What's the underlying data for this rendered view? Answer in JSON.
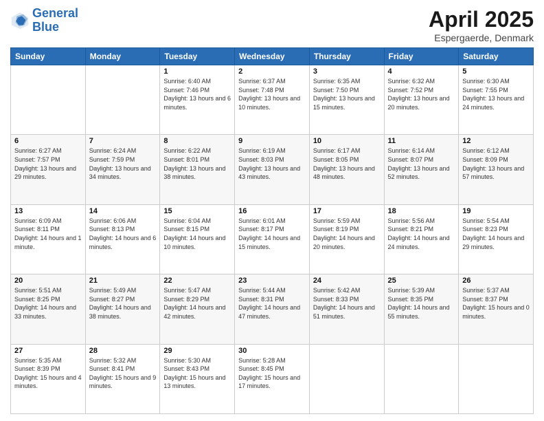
{
  "logo": {
    "line1": "General",
    "line2": "Blue"
  },
  "title": "April 2025",
  "location": "Espergaerde, Denmark",
  "weekdays": [
    "Sunday",
    "Monday",
    "Tuesday",
    "Wednesday",
    "Thursday",
    "Friday",
    "Saturday"
  ],
  "days": [
    {
      "num": "",
      "info": ""
    },
    {
      "num": "",
      "info": ""
    },
    {
      "num": "1",
      "info": "Sunrise: 6:40 AM\nSunset: 7:46 PM\nDaylight: 13 hours and 6 minutes."
    },
    {
      "num": "2",
      "info": "Sunrise: 6:37 AM\nSunset: 7:48 PM\nDaylight: 13 hours and 10 minutes."
    },
    {
      "num": "3",
      "info": "Sunrise: 6:35 AM\nSunset: 7:50 PM\nDaylight: 13 hours and 15 minutes."
    },
    {
      "num": "4",
      "info": "Sunrise: 6:32 AM\nSunset: 7:52 PM\nDaylight: 13 hours and 20 minutes."
    },
    {
      "num": "5",
      "info": "Sunrise: 6:30 AM\nSunset: 7:55 PM\nDaylight: 13 hours and 24 minutes."
    },
    {
      "num": "6",
      "info": "Sunrise: 6:27 AM\nSunset: 7:57 PM\nDaylight: 13 hours and 29 minutes."
    },
    {
      "num": "7",
      "info": "Sunrise: 6:24 AM\nSunset: 7:59 PM\nDaylight: 13 hours and 34 minutes."
    },
    {
      "num": "8",
      "info": "Sunrise: 6:22 AM\nSunset: 8:01 PM\nDaylight: 13 hours and 38 minutes."
    },
    {
      "num": "9",
      "info": "Sunrise: 6:19 AM\nSunset: 8:03 PM\nDaylight: 13 hours and 43 minutes."
    },
    {
      "num": "10",
      "info": "Sunrise: 6:17 AM\nSunset: 8:05 PM\nDaylight: 13 hours and 48 minutes."
    },
    {
      "num": "11",
      "info": "Sunrise: 6:14 AM\nSunset: 8:07 PM\nDaylight: 13 hours and 52 minutes."
    },
    {
      "num": "12",
      "info": "Sunrise: 6:12 AM\nSunset: 8:09 PM\nDaylight: 13 hours and 57 minutes."
    },
    {
      "num": "13",
      "info": "Sunrise: 6:09 AM\nSunset: 8:11 PM\nDaylight: 14 hours and 1 minute."
    },
    {
      "num": "14",
      "info": "Sunrise: 6:06 AM\nSunset: 8:13 PM\nDaylight: 14 hours and 6 minutes."
    },
    {
      "num": "15",
      "info": "Sunrise: 6:04 AM\nSunset: 8:15 PM\nDaylight: 14 hours and 10 minutes."
    },
    {
      "num": "16",
      "info": "Sunrise: 6:01 AM\nSunset: 8:17 PM\nDaylight: 14 hours and 15 minutes."
    },
    {
      "num": "17",
      "info": "Sunrise: 5:59 AM\nSunset: 8:19 PM\nDaylight: 14 hours and 20 minutes."
    },
    {
      "num": "18",
      "info": "Sunrise: 5:56 AM\nSunset: 8:21 PM\nDaylight: 14 hours and 24 minutes."
    },
    {
      "num": "19",
      "info": "Sunrise: 5:54 AM\nSunset: 8:23 PM\nDaylight: 14 hours and 29 minutes."
    },
    {
      "num": "20",
      "info": "Sunrise: 5:51 AM\nSunset: 8:25 PM\nDaylight: 14 hours and 33 minutes."
    },
    {
      "num": "21",
      "info": "Sunrise: 5:49 AM\nSunset: 8:27 PM\nDaylight: 14 hours and 38 minutes."
    },
    {
      "num": "22",
      "info": "Sunrise: 5:47 AM\nSunset: 8:29 PM\nDaylight: 14 hours and 42 minutes."
    },
    {
      "num": "23",
      "info": "Sunrise: 5:44 AM\nSunset: 8:31 PM\nDaylight: 14 hours and 47 minutes."
    },
    {
      "num": "24",
      "info": "Sunrise: 5:42 AM\nSunset: 8:33 PM\nDaylight: 14 hours and 51 minutes."
    },
    {
      "num": "25",
      "info": "Sunrise: 5:39 AM\nSunset: 8:35 PM\nDaylight: 14 hours and 55 minutes."
    },
    {
      "num": "26",
      "info": "Sunrise: 5:37 AM\nSunset: 8:37 PM\nDaylight: 15 hours and 0 minutes."
    },
    {
      "num": "27",
      "info": "Sunrise: 5:35 AM\nSunset: 8:39 PM\nDaylight: 15 hours and 4 minutes."
    },
    {
      "num": "28",
      "info": "Sunrise: 5:32 AM\nSunset: 8:41 PM\nDaylight: 15 hours and 9 minutes."
    },
    {
      "num": "29",
      "info": "Sunrise: 5:30 AM\nSunset: 8:43 PM\nDaylight: 15 hours and 13 minutes."
    },
    {
      "num": "30",
      "info": "Sunrise: 5:28 AM\nSunset: 8:45 PM\nDaylight: 15 hours and 17 minutes."
    },
    {
      "num": "",
      "info": ""
    },
    {
      "num": "",
      "info": ""
    },
    {
      "num": "",
      "info": ""
    }
  ]
}
